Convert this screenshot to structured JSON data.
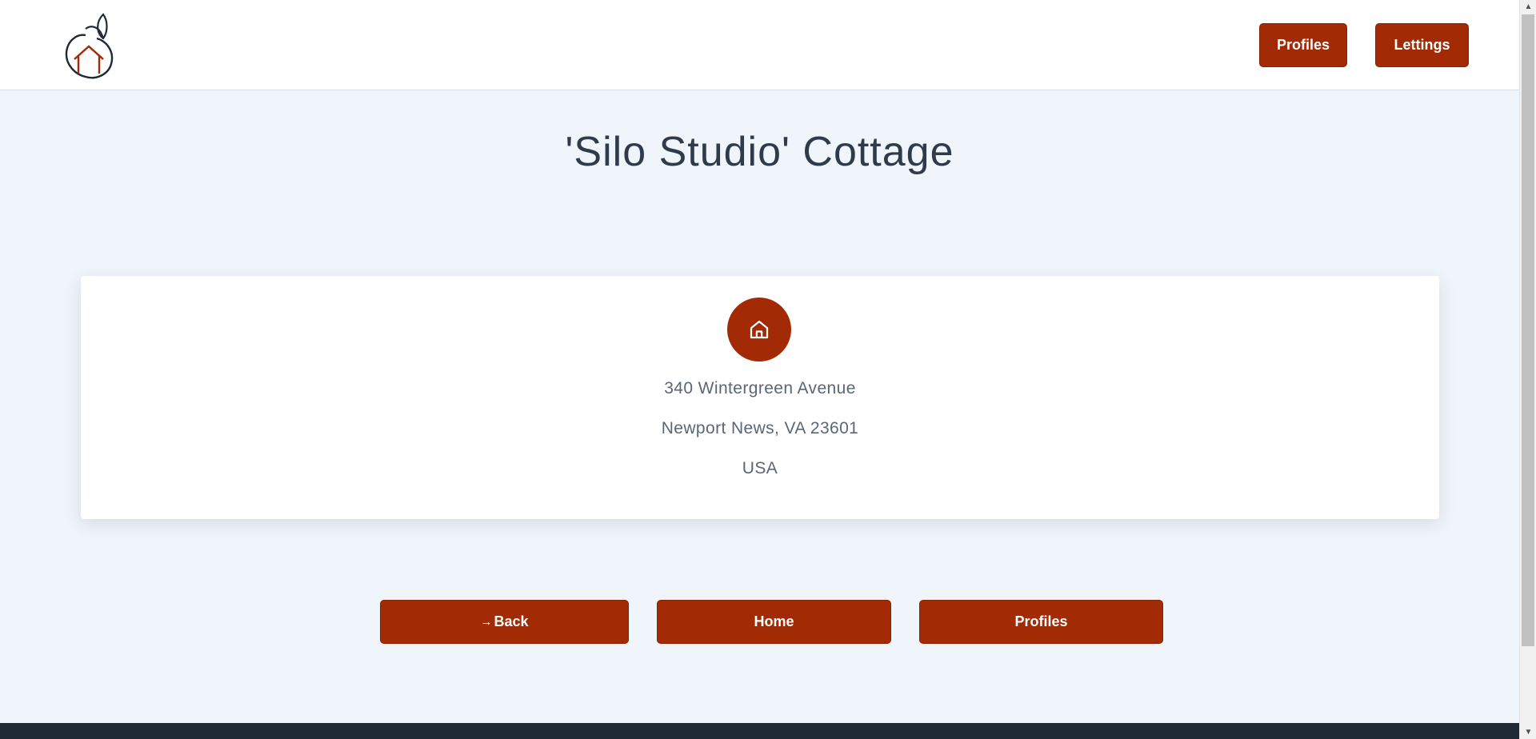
{
  "header": {
    "logo_icon": "house-apple-logo",
    "nav": {
      "profiles_label": "Profiles",
      "lettings_label": "Lettings"
    }
  },
  "main": {
    "title": "'Silo Studio' Cottage",
    "card": {
      "icon": "house-icon",
      "address_line1": "340 Wintergreen Avenue",
      "address_line2": "Newport News, VA 23601",
      "country": "USA"
    },
    "actions": {
      "back_arrow": "→",
      "back_label": "Back",
      "home_label": "Home",
      "profiles_label": "Profiles"
    }
  },
  "colors": {
    "accent": "#a22a05",
    "background": "#f0f4fb",
    "footer": "#1f2a36"
  }
}
